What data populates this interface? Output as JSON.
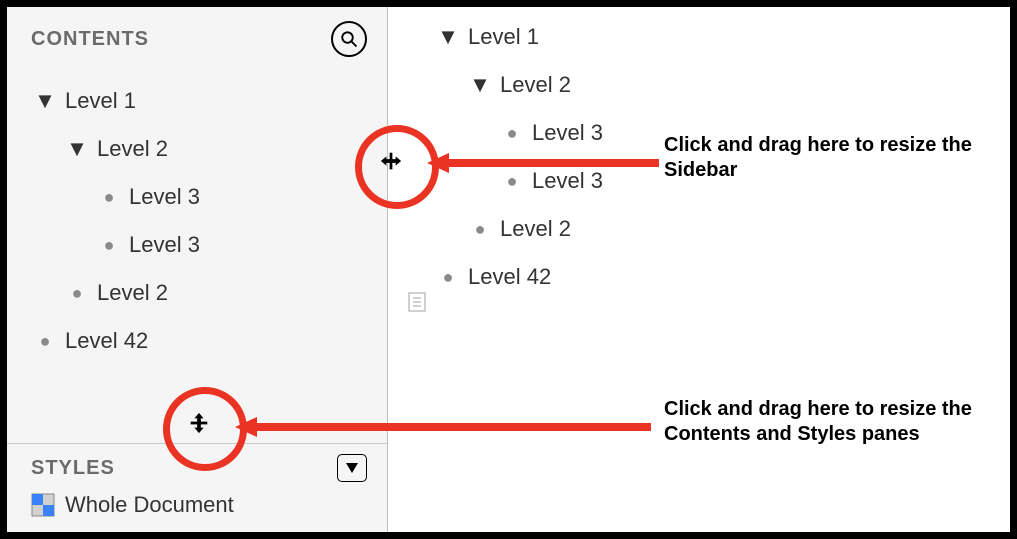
{
  "sidebar": {
    "contents": {
      "header": "CONTENTS",
      "items": [
        {
          "level": 1,
          "type": "triangle",
          "label": "Level 1"
        },
        {
          "level": 2,
          "type": "triangle",
          "label": "Level 2"
        },
        {
          "level": 3,
          "type": "bullet",
          "label": "Level 3"
        },
        {
          "level": 3,
          "type": "bullet",
          "label": "Level 3"
        },
        {
          "level": 2,
          "type": "bullet",
          "label": "Level 2"
        },
        {
          "level": 1,
          "type": "bullet",
          "label": "Level 42"
        }
      ]
    },
    "styles": {
      "header": "STYLES",
      "whole_document_label": "Whole Document"
    }
  },
  "main": {
    "items": [
      {
        "level": 0,
        "type": "triangle",
        "label": "Level 1"
      },
      {
        "level": 1,
        "type": "triangle",
        "label": "Level 2"
      },
      {
        "level": 2,
        "type": "bullet",
        "label": "Level 3"
      },
      {
        "level": 2,
        "type": "bullet",
        "label": "Level 3"
      },
      {
        "level": 1,
        "type": "bullet",
        "label": "Level 2"
      },
      {
        "level": 0,
        "type": "bullet",
        "label": "Level 42"
      }
    ]
  },
  "annotations": {
    "resize_sidebar": "Click and drag here to resize the Sidebar",
    "resize_panes": "Click and drag here to resize the Contents and Styles panes"
  },
  "colors": {
    "annotation_red": "#ea3323"
  }
}
